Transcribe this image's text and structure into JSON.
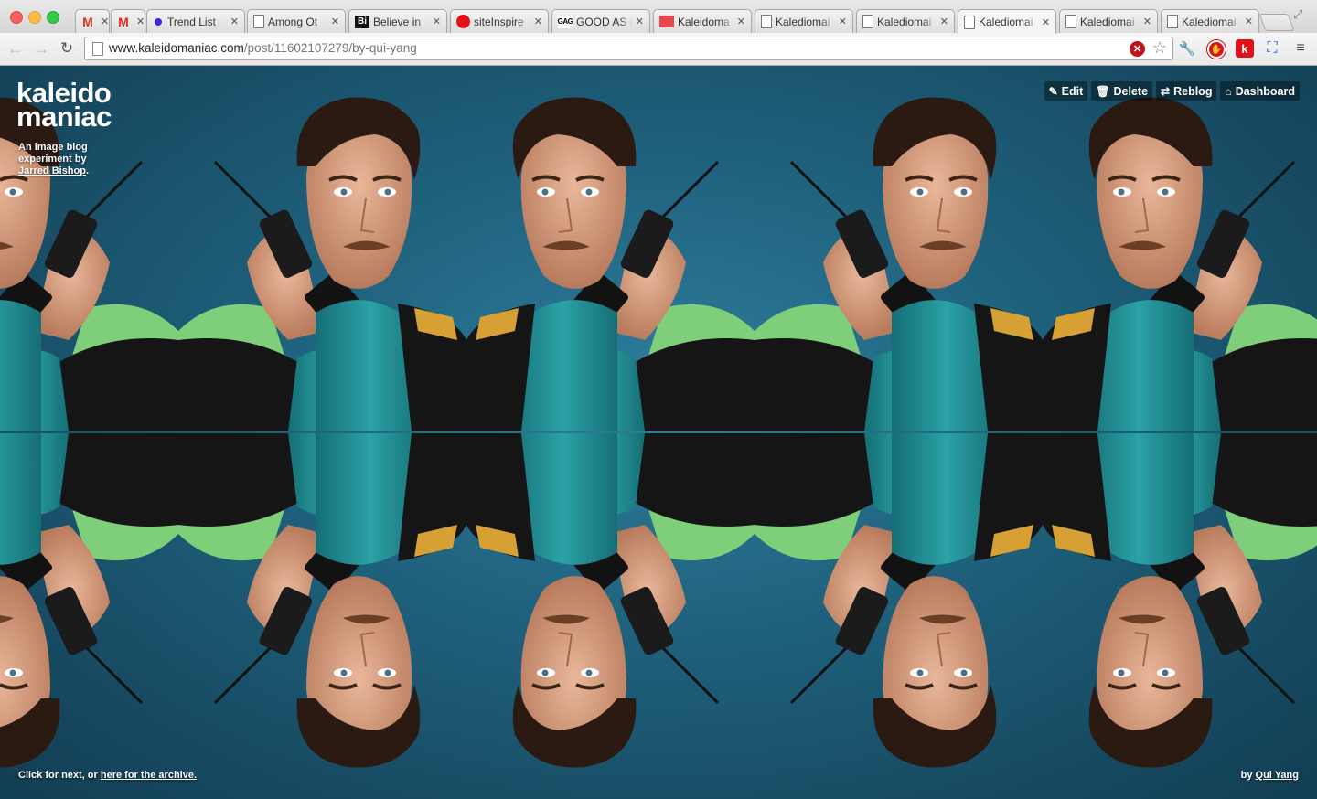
{
  "browser": {
    "tabs": [
      {
        "title": "",
        "favicon": "gmail-icon"
      },
      {
        "title": "",
        "favicon": "gmail-icon"
      },
      {
        "title": "Trend List",
        "favicon": "dot-icon"
      },
      {
        "title": "Among Ot",
        "favicon": "document-icon"
      },
      {
        "title": "Believe in",
        "favicon": "bi-icon"
      },
      {
        "title": "siteInspire",
        "favicon": "red-circle-icon"
      },
      {
        "title": "GOOD AS (",
        "favicon": "gag-icon"
      },
      {
        "title": "Kaleidoma",
        "favicon": "kaleidomaniac-icon"
      },
      {
        "title": "Kalediomai",
        "favicon": "document-icon"
      },
      {
        "title": "Kalediomai",
        "favicon": "document-icon"
      },
      {
        "title": "Kalediomai",
        "favicon": "document-icon"
      },
      {
        "title": "Kalediomai",
        "favicon": "document-icon"
      },
      {
        "title": "Kalediomai",
        "favicon": "document-icon"
      }
    ],
    "active_tab_index": 9,
    "url_domain": "www.kaleidomaniac.com",
    "url_path": "/post/11602107279/by-qui-yang"
  },
  "page": {
    "logo_line1": "kaleido",
    "logo_line2": "maniac",
    "tagline_prefix": "An image blog experiment by ",
    "tagline_link": "Jarred Bishop",
    "tagline_suffix": ".",
    "controls": {
      "edit": "Edit",
      "delete": "Delete",
      "reblog": "Reblog",
      "dashboard": "Dashboard"
    },
    "footer_prefix": "Click for next, or ",
    "footer_link": "here for the archive.",
    "credit_prefix": "by ",
    "credit_link": "Qui Yang"
  },
  "colors": {
    "background": "#1e5f7a",
    "jacket": "#111111",
    "teal_shirt": "#1f8e93",
    "green_sleeve": "#7fcf7a"
  }
}
